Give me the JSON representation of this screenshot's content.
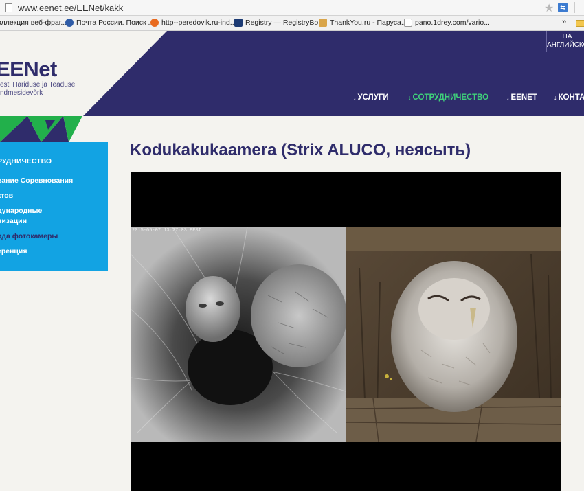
{
  "browser": {
    "url": "www.eenet.ee/EENet/kakk",
    "bookmarks": [
      {
        "label": "оллекция веб-фраг...",
        "icon": "web-slice-icon"
      },
      {
        "label": "Почта России. Поиск ...",
        "icon": "russian-post-icon"
      },
      {
        "label": "http--peredovik.ru-ind...",
        "icon": "firefox-icon"
      },
      {
        "label": "Registry — RegistryBo...",
        "icon": "registry-icon"
      },
      {
        "label": "ThankYou.ru - Паруса...",
        "icon": "thankyou-icon"
      },
      {
        "label": "pano.1drey.com/vario...",
        "icon": "page-icon"
      }
    ],
    "more": "»"
  },
  "header": {
    "logo_title": "EENet",
    "logo_sub1": "esti Hariduse ja Teaduse",
    "logo_sub2": "ndmesidevõrk",
    "lang": "НА АНГЛИЙСКОМ",
    "nav": [
      {
        "label": "УСЛУГИ",
        "active": false
      },
      {
        "label": "СОТРУДНИЧЕСТВО",
        "active": true
      },
      {
        "label": "EENET",
        "active": false
      },
      {
        "label": "КОНТА",
        "active": false
      }
    ],
    "nav_arrow": "↓"
  },
  "sidebar": {
    "heading": "РУДНИЧЕСТВО",
    "items": [
      {
        "label": "вание Соревнования",
        "active": false
      },
      {
        "label": "ктов",
        "active": false
      },
      {
        "label": "дународные",
        "active": false
      },
      {
        "label": "низации",
        "active": false
      },
      {
        "label": "ода фотокамеры",
        "active": true
      },
      {
        "label": "еренция",
        "active": false
      }
    ]
  },
  "main": {
    "title": "Kodukakukaamera (Strix ALUCO, неясыть)",
    "camera_stamp": "2015-05-07 13:27:03 EEST"
  },
  "colors": {
    "brand_navy": "#2f2c6b",
    "accent_green": "#3fd07a",
    "sidebar_blue": "#12a3e3"
  }
}
